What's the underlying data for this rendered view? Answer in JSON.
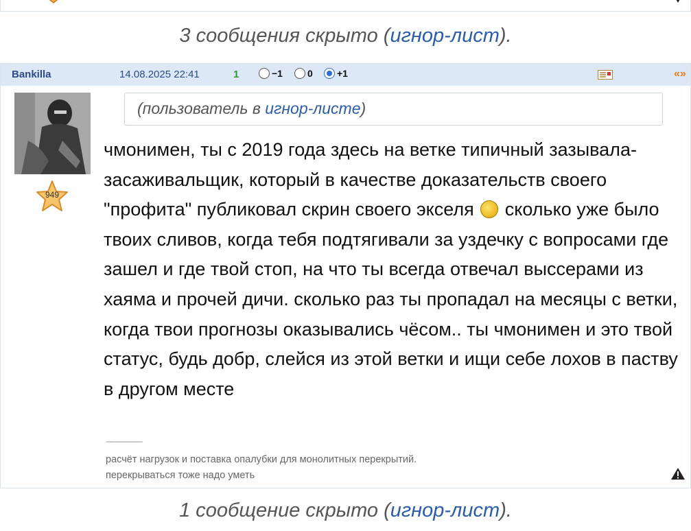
{
  "hidden_top": {
    "prefix": "3 сообщения скрыто (",
    "link": "игнор-лист",
    "suffix": ")."
  },
  "hidden_bottom": {
    "prefix": "1 сообщение скрыто (",
    "link": "игнор-лист",
    "suffix": ")."
  },
  "post": {
    "author": "Bankilla",
    "date": "14.08.2025 22:41",
    "rating": "1",
    "votes": [
      {
        "label": "−1",
        "checked": false
      },
      {
        "label": "0",
        "checked": false
      },
      {
        "label": "+1",
        "checked": true
      }
    ],
    "quote_label": "«»",
    "user_stars": "949",
    "ignore_notice": {
      "prefix": "(пользователь в ",
      "link": "игнор-листе",
      "suffix": ")"
    },
    "message_part1": "чмонимен, ты с 2019 года здесь на ветке типичный зазывала-засаживальщик, который в качестве доказательств своего \"профита\" публиковал скрин своего экселя",
    "message_part2": " сколько уже было твоих сливов, когда тебя подтягивали за уздечку с вопросами где зашел и где твой стоп, на что ты всегда отвечал выссерами из хаяма и прочей дичи. сколько раз ты пропадал на месяцы с ветки, когда твои прогнозы оказывались чёсом.. ты чмонимен и это твой статус, будь добр, слейся из этой ветки и ищи себе лохов в паству в другом месте",
    "signature_separator": "--------------------",
    "signature_line1": "расчёт нагрузок и поставка опалубки для монолитных перекрытий.",
    "signature_line2": "перекрываться тоже надо уметь"
  },
  "icons": {
    "emoji": "money-emoji-icon",
    "pm": "private-message-icon",
    "warn": "warning-triangle-icon",
    "star": "star-badge-icon"
  },
  "colors": {
    "header_bg": "#dde8f7",
    "link": "#2a5cac",
    "rating_green": "#2c9b2c",
    "quote_orange": "#e8781e"
  }
}
